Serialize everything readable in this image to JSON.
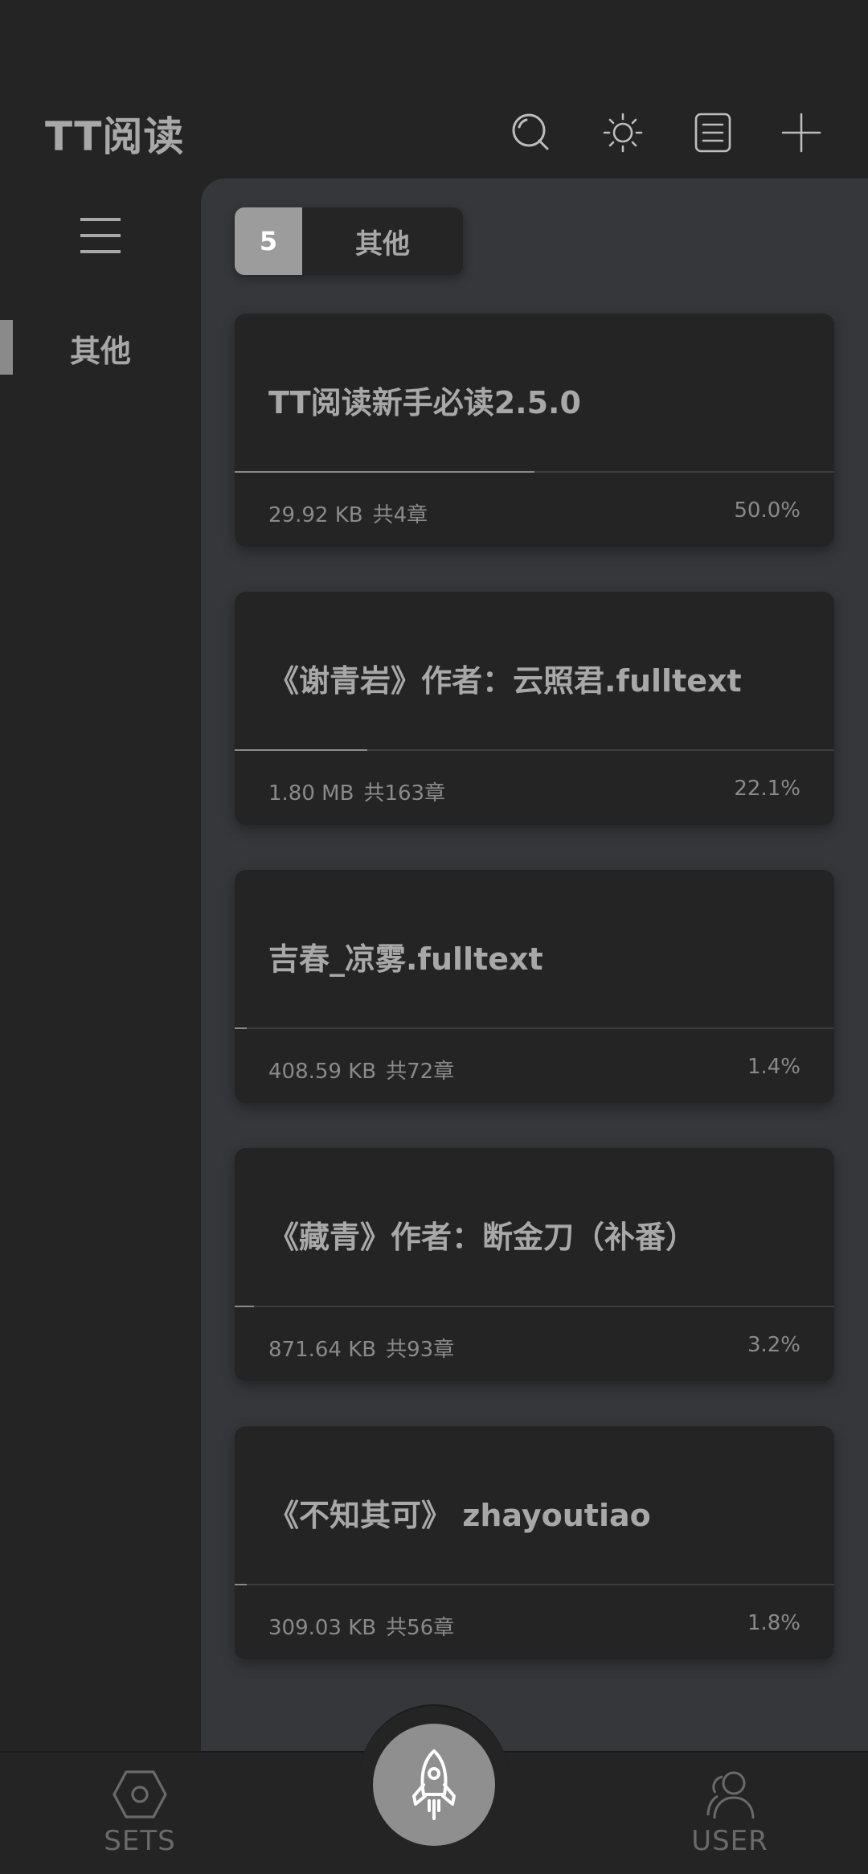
{
  "header": {
    "title": "TT阅读",
    "icons": [
      "search-icon",
      "brightness-icon",
      "list-icon",
      "add-icon"
    ]
  },
  "sidebar": {
    "menu_icon": "menu-icon",
    "items": [
      {
        "label": "其他",
        "active": true
      }
    ]
  },
  "group": {
    "count": "5",
    "label": "其他"
  },
  "books": [
    {
      "title": "TT阅读新手必读2.5.0",
      "size": "29.92 KB",
      "chapters": "共4章",
      "percent": "50.0%",
      "progress": 0.5
    },
    {
      "title": "《谢青岩》作者：云照君.fulltext",
      "size": "1.80 MB",
      "chapters": "共163章",
      "percent": "22.1%",
      "progress": 0.221
    },
    {
      "title": "吉春_凉雾.fulltext",
      "size": "408.59 KB",
      "chapters": "共72章",
      "percent": "1.4%",
      "progress": 0.014
    },
    {
      "title": "《藏青》作者：断金刀（补番）",
      "size": "871.64 KB",
      "chapters": "共93章",
      "percent": "3.2%",
      "progress": 0.032
    },
    {
      "title": "《不知其可》 zhayoutiao",
      "size": "309.03 KB",
      "chapters": "共56章",
      "percent": "1.8%",
      "progress": 0.018
    }
  ],
  "bottom_nav": {
    "sets_label": "SETS",
    "user_label": "USER",
    "fab_icon": "rocket-icon"
  },
  "colors": {
    "background": "#242424",
    "panel": "#36373b",
    "text": "#a8a8a8",
    "accent": "#8f8f8f"
  }
}
